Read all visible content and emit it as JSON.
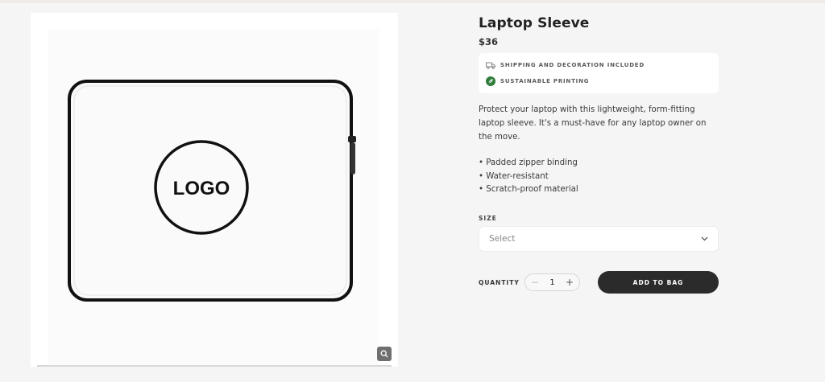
{
  "product": {
    "title": "Laptop Sleeve",
    "price": "$36",
    "image_logo_text": "LOGO"
  },
  "perks": [
    {
      "icon": "truck-icon",
      "label": "SHIPPING AND DECORATION INCLUDED"
    },
    {
      "icon": "leaf-icon",
      "label": "SUSTAINABLE PRINTING",
      "color": "#2e7d3a"
    }
  ],
  "description": "Protect your laptop with this lightweight, form-fitting laptop sleeve. It's a must-have for any laptop owner on the move.",
  "features": [
    "• Padded zipper binding",
    "• Water-resistant",
    "• Scratch-proof material"
  ],
  "size": {
    "label": "SIZE",
    "placeholder": "Select"
  },
  "quantity": {
    "label": "QUANTITY",
    "value": "1",
    "minus": "−",
    "plus": "+"
  },
  "cart": {
    "add_label": "ADD TO BAG",
    "button_color": "#2b2b2b"
  }
}
